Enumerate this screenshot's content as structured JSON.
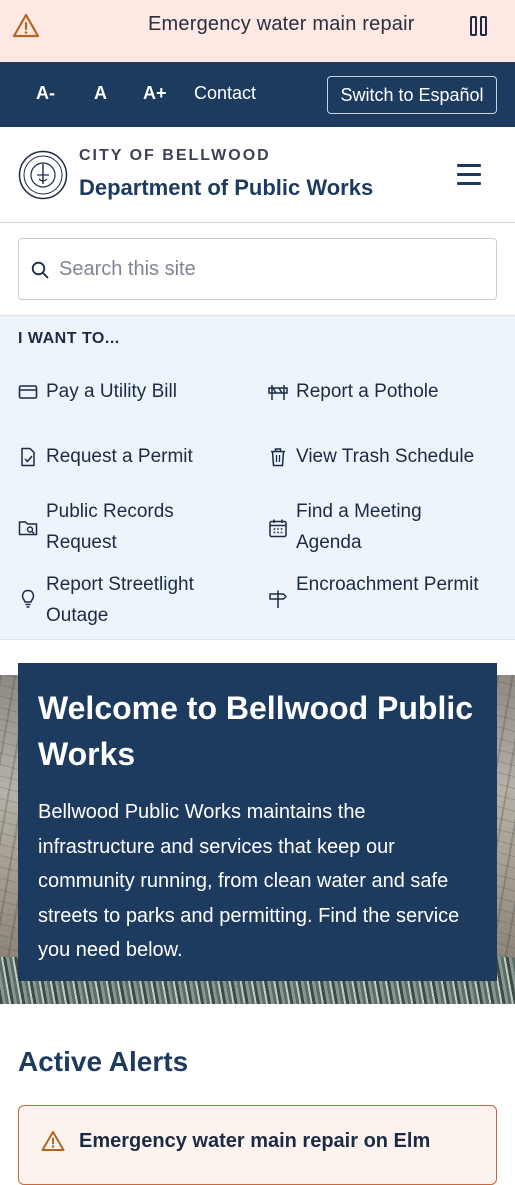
{
  "alert_banner": {
    "text": "Emergency water main repair",
    "icon": "warning-icon",
    "pause_icon": "pause-icon"
  },
  "utility_bar": {
    "text_smaller": "A-",
    "text_default": "A",
    "text_larger": "A+",
    "contact": "Contact",
    "language": "Switch to Español"
  },
  "header": {
    "city": "CITY OF BELLWOOD",
    "department": "Department of Public Works",
    "menu_icon": "hamburger-menu-icon"
  },
  "search": {
    "placeholder": "Search this site",
    "value": ""
  },
  "i_want_to": {
    "heading": "I WANT TO...",
    "tasks": [
      {
        "label": "Pay a Utility Bill",
        "icon": "credit-card-icon"
      },
      {
        "label": "Report a Pothole",
        "icon": "road-barrier-icon"
      },
      {
        "label": "Request a Permit",
        "icon": "document-check-icon"
      },
      {
        "label": "View Trash Schedule",
        "icon": "trash-can-icon"
      },
      {
        "label": "Public Records Request",
        "icon": "folder-search-icon"
      },
      {
        "label": "Find a Meeting Agenda",
        "icon": "calendar-icon"
      },
      {
        "label": "Report Streetlight Outage",
        "icon": "lightbulb-icon"
      },
      {
        "label": "Encroachment Permit",
        "icon": "signpost-icon"
      }
    ]
  },
  "hero": {
    "title": "Welcome to Bellwood Public Works",
    "text": "Bellwood Public Works maintains the infrastructure and services that keep our community running, from clean water and safe streets to parks and permitting. Find the service you need below."
  },
  "alerts": {
    "heading": "Active Alerts",
    "items": [
      {
        "title": "Emergency water main repair on Elm"
      }
    ]
  },
  "colors": {
    "brand_navy": "#1d3a5f",
    "alert_bg": "#fde8e4",
    "warning_orange": "#c4683f",
    "panel_bg": "#eef4fb"
  }
}
